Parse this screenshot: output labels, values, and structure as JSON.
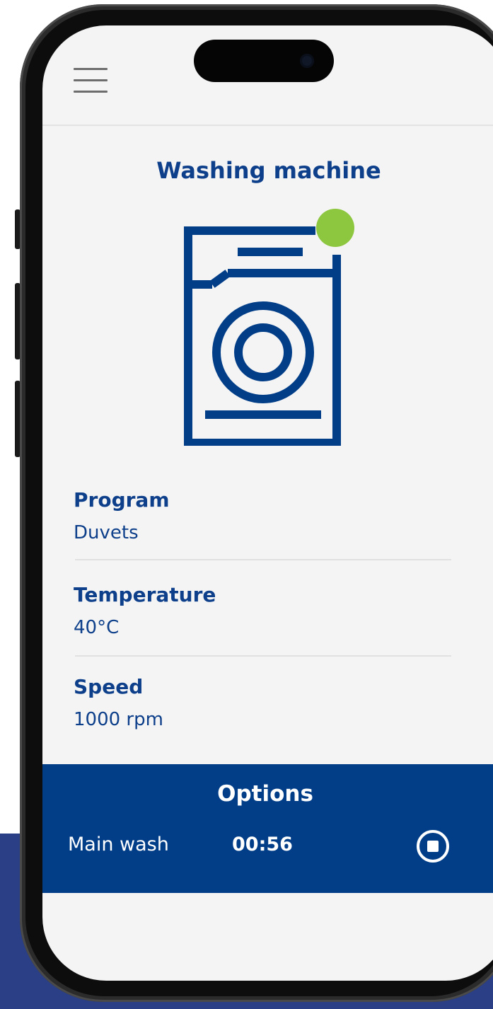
{
  "appliance": {
    "title": "Washing machine",
    "status_color": "#8dc63f",
    "icon": "washing-machine-icon"
  },
  "settings": [
    {
      "label": "Program",
      "value": "Duvets"
    },
    {
      "label": "Temperature",
      "value": "40°C"
    },
    {
      "label": "Speed",
      "value": "1000 rpm"
    }
  ],
  "options": {
    "title": "Options",
    "phase": "Main wash",
    "time_remaining": "00:56",
    "stop_icon": "stop-icon"
  },
  "colors": {
    "primary": "#023e88",
    "text": "#0d3f8a",
    "status_on": "#8dc63f",
    "background": "#f4f4f4"
  }
}
